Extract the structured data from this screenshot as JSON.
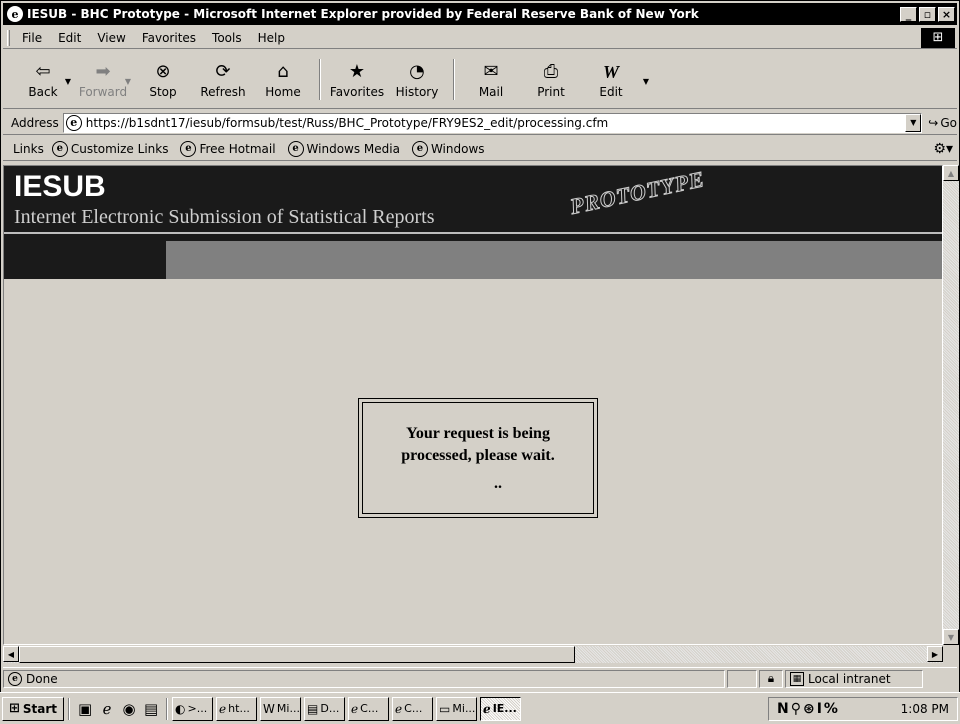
{
  "window": {
    "title": "IESUB - BHC Prototype - Microsoft Internet Explorer provided by Federal Reserve Bank of New York",
    "buttons": [
      "_",
      "▫",
      "×"
    ]
  },
  "menubar": {
    "items": [
      "File",
      "Edit",
      "View",
      "Favorites",
      "Tools",
      "Help"
    ]
  },
  "toolbar": {
    "buttons": [
      {
        "label": "Back",
        "icon": "back-arrow-icon",
        "glyph": "⇦"
      },
      {
        "label": "Forward",
        "icon": "forward-arrow-icon",
        "glyph": "➡"
      },
      {
        "label": "Stop",
        "icon": "stop-icon",
        "glyph": "⊗"
      },
      {
        "label": "Refresh",
        "icon": "refresh-icon",
        "glyph": "⟳"
      },
      {
        "label": "Home",
        "icon": "home-icon",
        "glyph": "⌂"
      },
      {
        "label": "Favorites",
        "icon": "favorites-icon",
        "glyph": "★"
      },
      {
        "label": "History",
        "icon": "history-icon",
        "glyph": "◔"
      },
      {
        "label": "Mail",
        "icon": "mail-icon",
        "glyph": "✉"
      },
      {
        "label": "Print",
        "icon": "print-icon",
        "glyph": "⎙"
      },
      {
        "label": "Edit",
        "icon": "edit-icon",
        "glyph": "W"
      }
    ]
  },
  "address": {
    "label": "Address",
    "url": "https://b1sdnt17/iesub/formsub/test/Russ/BHC_Prototype/FRY9ES2_edit/processing.cfm",
    "go_label": "Go"
  },
  "links": {
    "label": "Links",
    "items": [
      "Customize Links",
      "Free Hotmail",
      "Windows Media",
      "Windows"
    ]
  },
  "page": {
    "logo": "IESUB",
    "subtitle": "Internet Electronic Submission of Statistical Reports",
    "watermark": "PROTOTYPE",
    "message_line1": "Your request is being",
    "message_line2": "processed, please wait.",
    "dots": ".."
  },
  "status": {
    "text": "Done",
    "zone": "Local intranet"
  },
  "taskbar": {
    "start_label": "Start",
    "tasks": [
      ">...",
      "ht...",
      "Mi...",
      "D...",
      "C...",
      "C...",
      "Mi...",
      "IE..."
    ],
    "tray_icons": "N⚲⊛I%",
    "clock": "1:08 PM"
  }
}
